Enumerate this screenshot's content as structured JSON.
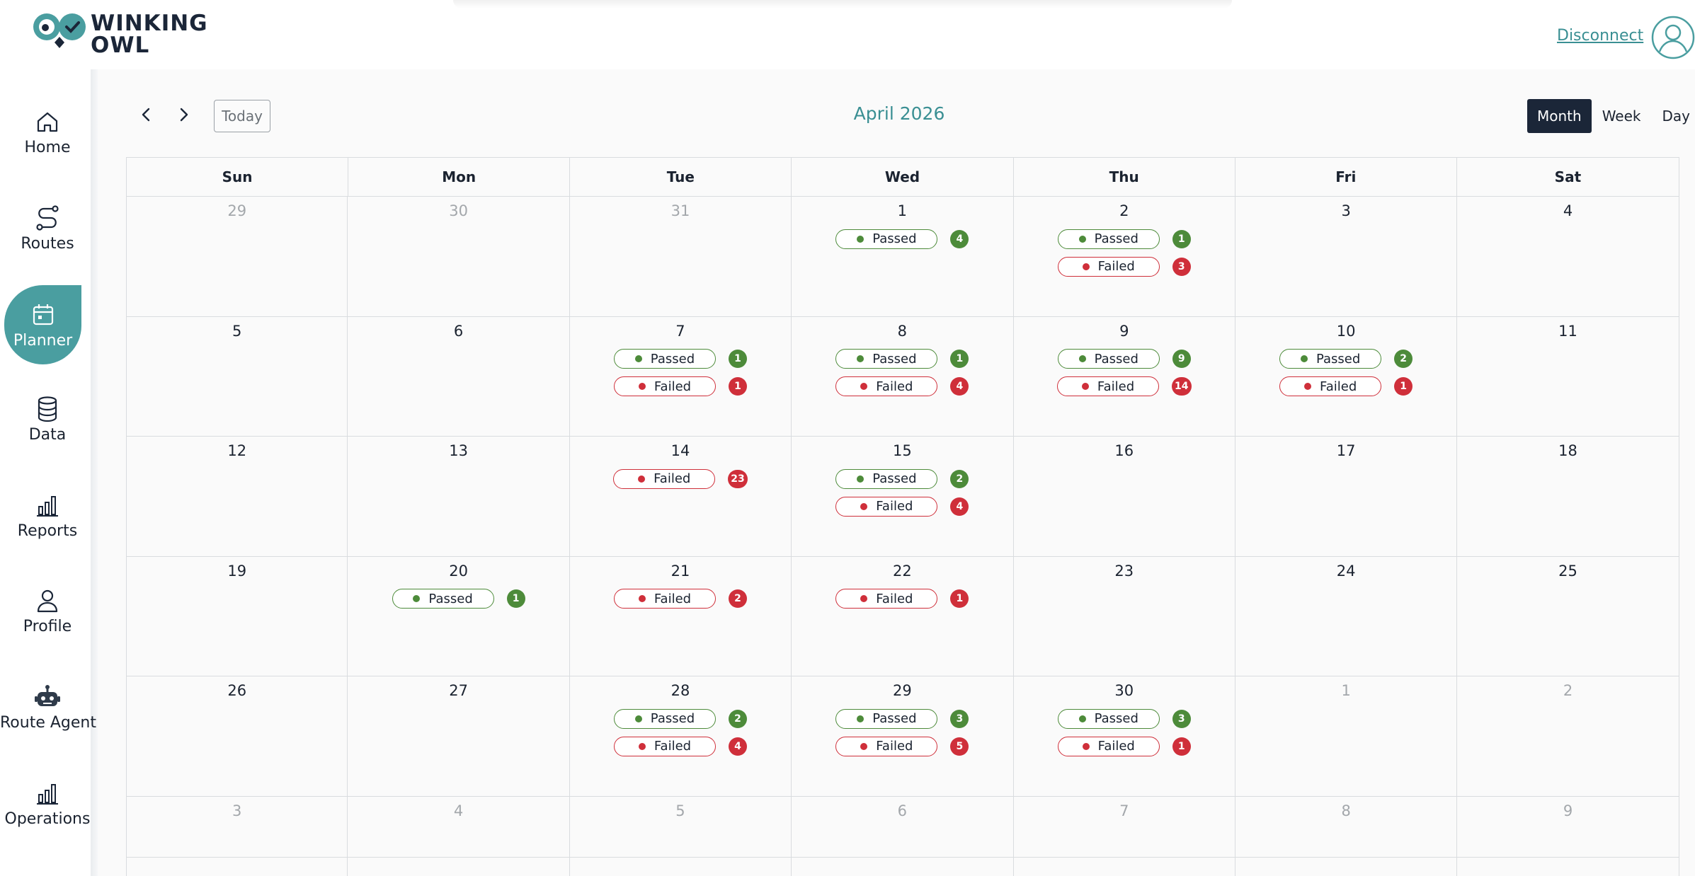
{
  "header": {
    "brand_line1": "WINKING",
    "brand_line2": "OWL",
    "disconnect_label": "Disconnect"
  },
  "sidebar": {
    "items": [
      {
        "label": "Home",
        "icon": "home-icon"
      },
      {
        "label": "Routes",
        "icon": "route-icon"
      },
      {
        "label": "Planner",
        "icon": "calendar-icon",
        "active": true
      },
      {
        "label": "Data",
        "icon": "database-icon"
      },
      {
        "label": "Reports",
        "icon": "bar-chart-icon"
      },
      {
        "label": "Profile",
        "icon": "user-icon"
      },
      {
        "label": "Route Agent",
        "icon": "robot-icon"
      },
      {
        "label": "Operations",
        "icon": "bar-chart-icon"
      }
    ]
  },
  "toolbar": {
    "today_label": "Today",
    "month_title": "April 2026",
    "views": [
      "Month",
      "Week",
      "Day"
    ],
    "active_view": "Month"
  },
  "calendar": {
    "weekdays": [
      "Sun",
      "Mon",
      "Tue",
      "Wed",
      "Thu",
      "Fri",
      "Sat"
    ],
    "weeks": [
      [
        {
          "day": "29",
          "other": true,
          "events": []
        },
        {
          "day": "30",
          "other": true,
          "events": []
        },
        {
          "day": "31",
          "other": true,
          "events": []
        },
        {
          "day": "1",
          "events": [
            {
              "status": "passed",
              "label": "Passed",
              "count": "4"
            }
          ]
        },
        {
          "day": "2",
          "events": [
            {
              "status": "passed",
              "label": "Passed",
              "count": "1"
            },
            {
              "status": "failed",
              "label": "Failed",
              "count": "3"
            }
          ]
        },
        {
          "day": "3",
          "events": []
        },
        {
          "day": "4",
          "events": []
        }
      ],
      [
        {
          "day": "5",
          "events": []
        },
        {
          "day": "6",
          "events": []
        },
        {
          "day": "7",
          "events": [
            {
              "status": "passed",
              "label": "Passed",
              "count": "1"
            },
            {
              "status": "failed",
              "label": "Failed",
              "count": "1"
            }
          ]
        },
        {
          "day": "8",
          "events": [
            {
              "status": "passed",
              "label": "Passed",
              "count": "1"
            },
            {
              "status": "failed",
              "label": "Failed",
              "count": "4"
            }
          ]
        },
        {
          "day": "9",
          "events": [
            {
              "status": "passed",
              "label": "Passed",
              "count": "9"
            },
            {
              "status": "failed",
              "label": "Failed",
              "count": "14"
            }
          ]
        },
        {
          "day": "10",
          "events": [
            {
              "status": "passed",
              "label": "Passed",
              "count": "2"
            },
            {
              "status": "failed",
              "label": "Failed",
              "count": "1"
            }
          ]
        },
        {
          "day": "11",
          "events": []
        }
      ],
      [
        {
          "day": "12",
          "events": []
        },
        {
          "day": "13",
          "events": []
        },
        {
          "day": "14",
          "events": [
            {
              "status": "failed",
              "label": "Failed",
              "count": "23"
            }
          ]
        },
        {
          "day": "15",
          "events": [
            {
              "status": "passed",
              "label": "Passed",
              "count": "2"
            },
            {
              "status": "failed",
              "label": "Failed",
              "count": "4"
            }
          ]
        },
        {
          "day": "16",
          "events": []
        },
        {
          "day": "17",
          "events": []
        },
        {
          "day": "18",
          "events": []
        }
      ],
      [
        {
          "day": "19",
          "events": []
        },
        {
          "day": "20",
          "events": [
            {
              "status": "passed",
              "label": "Passed",
              "count": "1"
            }
          ]
        },
        {
          "day": "21",
          "events": [
            {
              "status": "failed",
              "label": "Failed",
              "count": "2"
            }
          ]
        },
        {
          "day": "22",
          "events": [
            {
              "status": "failed",
              "label": "Failed",
              "count": "1"
            }
          ]
        },
        {
          "day": "23",
          "events": []
        },
        {
          "day": "24",
          "events": []
        },
        {
          "day": "25",
          "events": []
        }
      ],
      [
        {
          "day": "26",
          "events": []
        },
        {
          "day": "27",
          "events": []
        },
        {
          "day": "28",
          "events": [
            {
              "status": "passed",
              "label": "Passed",
              "count": "2"
            },
            {
              "status": "failed",
              "label": "Failed",
              "count": "4"
            }
          ]
        },
        {
          "day": "29",
          "events": [
            {
              "status": "passed",
              "label": "Passed",
              "count": "3"
            },
            {
              "status": "failed",
              "label": "Failed",
              "count": "5"
            }
          ]
        },
        {
          "day": "30",
          "events": [
            {
              "status": "passed",
              "label": "Passed",
              "count": "3"
            },
            {
              "status": "failed",
              "label": "Failed",
              "count": "1"
            }
          ]
        },
        {
          "day": "1",
          "other": true,
          "events": []
        },
        {
          "day": "2",
          "other": true,
          "events": []
        }
      ],
      [
        {
          "day": "3",
          "other": true,
          "events": []
        },
        {
          "day": "4",
          "other": true,
          "events": []
        },
        {
          "day": "5",
          "other": true,
          "events": []
        },
        {
          "day": "6",
          "other": true,
          "events": []
        },
        {
          "day": "7",
          "other": true,
          "events": []
        },
        {
          "day": "8",
          "other": true,
          "events": []
        },
        {
          "day": "9",
          "other": true,
          "events": []
        }
      ]
    ]
  },
  "colors": {
    "brand_teal": "#4a9ea0",
    "dark_navy": "#1b2638",
    "passed_green": "#4d8b3a",
    "failed_red": "#cf2f3a"
  }
}
